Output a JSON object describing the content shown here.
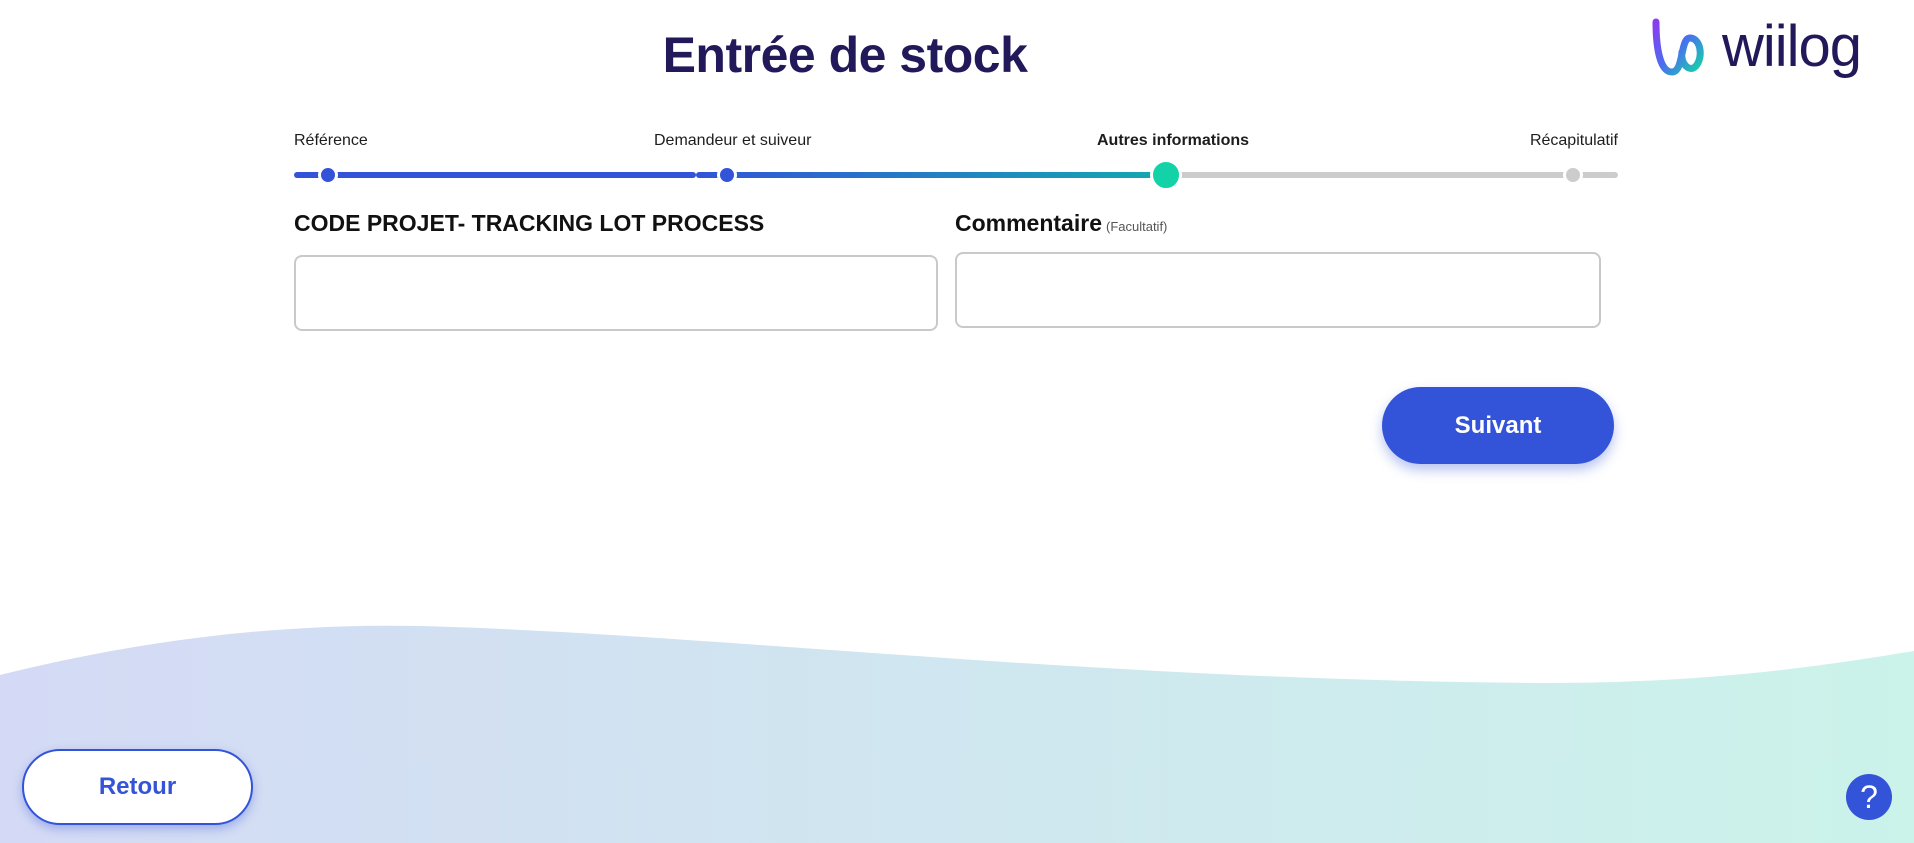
{
  "page": {
    "title": "Entrée de stock"
  },
  "brand": {
    "name": "wiilog",
    "logo_icon": "wiilog-logo-icon",
    "primary_color": "#3354d8",
    "dark_color": "#22195a",
    "active_step_color": "#13d2a7"
  },
  "stepper": {
    "steps": [
      {
        "label": "Référence",
        "state": "done"
      },
      {
        "label": "Demandeur et suiveur",
        "state": "done"
      },
      {
        "label": "Autres informations",
        "state": "current"
      },
      {
        "label": "Récapitulatif",
        "state": "pending"
      }
    ]
  },
  "form": {
    "project_code": {
      "label": "CODE PROJET- TRACKING LOT PROCESS",
      "value": "",
      "placeholder": ""
    },
    "comment": {
      "label": "Commentaire",
      "optional_hint": "(Facultatif)",
      "value": "",
      "placeholder": ""
    }
  },
  "actions": {
    "next_label": "Suivant",
    "back_label": "Retour",
    "help_icon": "question-mark-icon",
    "help_glyph": "?"
  }
}
